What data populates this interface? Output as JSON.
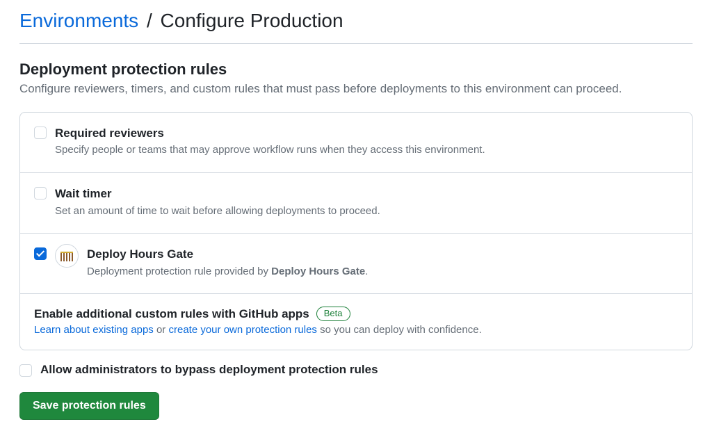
{
  "breadcrumb": {
    "parent": "Environments",
    "separator": "/",
    "current": "Configure Production"
  },
  "section": {
    "title": "Deployment protection rules",
    "description": "Configure reviewers, timers, and custom rules that must pass before deployments to this environment can proceed."
  },
  "rules": {
    "required_reviewers": {
      "title": "Required reviewers",
      "description": "Specify people or teams that may approve workflow runs when they access this environment.",
      "checked": false
    },
    "wait_timer": {
      "title": "Wait timer",
      "description": "Set an amount of time to wait before allowing deployments to proceed.",
      "checked": false
    },
    "deploy_hours_gate": {
      "title": "Deploy Hours Gate",
      "desc_prefix": "Deployment protection rule provided by ",
      "desc_app": "Deploy Hours Gate",
      "desc_suffix": ".",
      "checked": true
    },
    "custom": {
      "title": "Enable additional custom rules with GitHub apps",
      "badge": "Beta",
      "learn_link": "Learn about existing apps",
      "or_text": " or ",
      "create_link": "create your own protection rules",
      "tail_text": " so you can deploy with confidence."
    }
  },
  "bypass": {
    "label": "Allow administrators to bypass deployment protection rules",
    "checked": false
  },
  "save_button": "Save protection rules"
}
